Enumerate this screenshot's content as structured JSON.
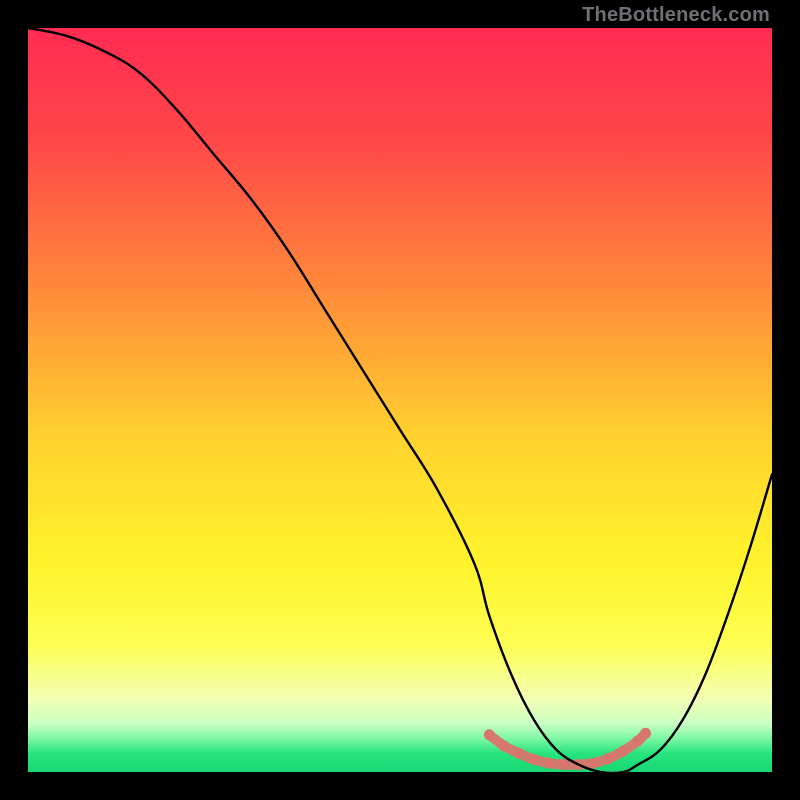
{
  "watermark": "TheBottleneck.com",
  "gradient_stops": [
    {
      "offset": 0.0,
      "color": "#ff2b52"
    },
    {
      "offset": 0.15,
      "color": "#ff4748"
    },
    {
      "offset": 0.35,
      "color": "#ff8a3a"
    },
    {
      "offset": 0.55,
      "color": "#ffd22e"
    },
    {
      "offset": 0.72,
      "color": "#fff42c"
    },
    {
      "offset": 0.83,
      "color": "#fdff53"
    },
    {
      "offset": 0.9,
      "color": "#f4ffb3"
    },
    {
      "offset": 0.935,
      "color": "#caffc3"
    },
    {
      "offset": 0.955,
      "color": "#7cf7a3"
    },
    {
      "offset": 0.975,
      "color": "#28e47e"
    },
    {
      "offset": 1.0,
      "color": "#17d873"
    }
  ],
  "chart_data": {
    "type": "line",
    "title": "",
    "xlabel": "",
    "ylabel": "",
    "xlim": [
      0,
      100
    ],
    "ylim": [
      0,
      100
    ],
    "series": [
      {
        "name": "bottleneck-curve",
        "x": [
          0,
          5,
          10,
          15,
          20,
          25,
          30,
          35,
          40,
          45,
          50,
          55,
          60,
          62,
          65,
          68,
          71,
          74,
          77,
          80,
          82,
          85,
          88,
          91,
          94,
          97,
          100
        ],
        "y": [
          100,
          99,
          97,
          94,
          89,
          83,
          77,
          70,
          62,
          54,
          46,
          38,
          28,
          21,
          13,
          7,
          3,
          1,
          0,
          0,
          1,
          3,
          7,
          13,
          21,
          30,
          40
        ]
      }
    ],
    "highlight_band": {
      "name": "optimal-range",
      "color": "#d8766e",
      "x_start": 62,
      "x_end": 82,
      "dots_x": [
        62,
        64,
        66,
        68,
        70,
        72,
        74,
        76,
        78,
        80,
        82,
        83
      ],
      "dots_y": [
        5,
        3.5,
        2.5,
        1.7,
        1.2,
        1.0,
        1.0,
        1.2,
        1.8,
        2.8,
        4.2,
        5.2
      ]
    }
  }
}
